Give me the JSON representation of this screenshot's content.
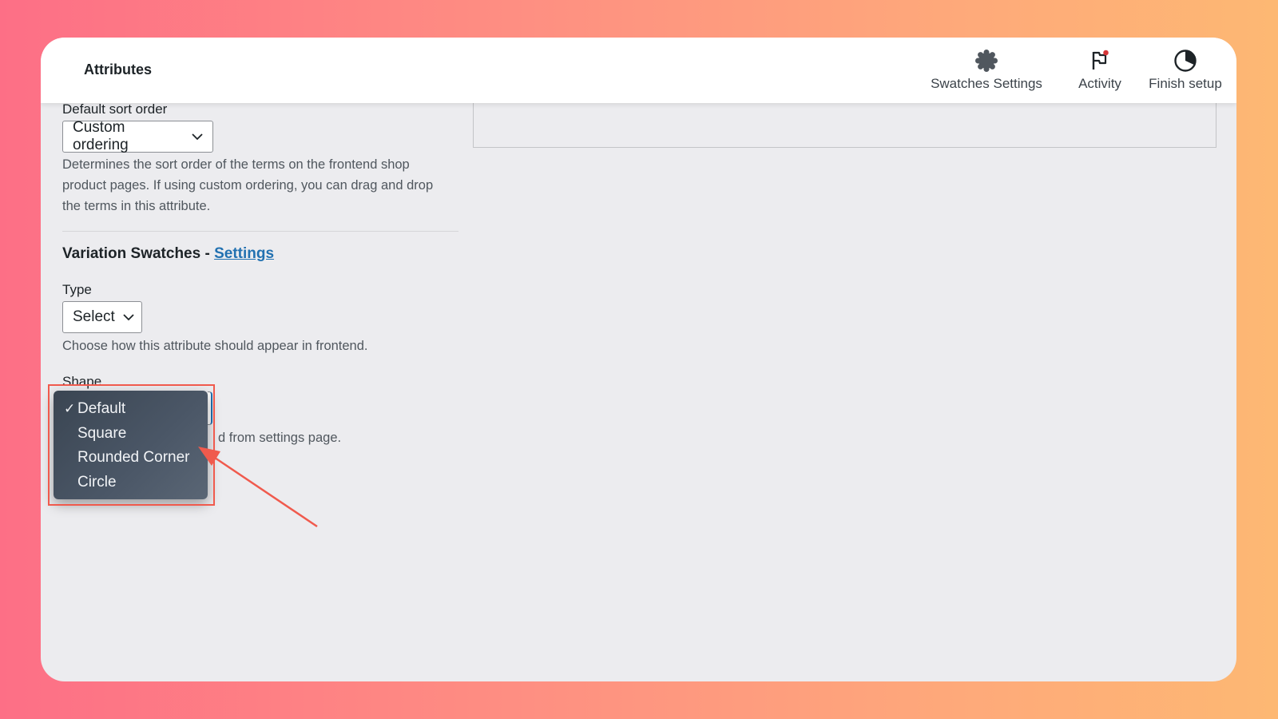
{
  "header": {
    "title": "Attributes",
    "actions": [
      {
        "label": "Swatches Settings",
        "icon": "gear-icon"
      },
      {
        "label": "Activity",
        "icon": "flag-icon"
      },
      {
        "label": "Finish setup",
        "icon": "progress-circle-icon"
      }
    ]
  },
  "sort_order": {
    "label": "Default sort order",
    "value": "Custom ordering",
    "description": "Determines the sort order of the terms on the frontend shop product pages. If using custom ordering, you can drag and drop the terms in this attribute."
  },
  "swatches_section": {
    "title": "Variation Swatches - ",
    "link": "Settings"
  },
  "type": {
    "label": "Type",
    "value": "Select",
    "description": "Choose how this attribute should appear in frontend."
  },
  "shape": {
    "label": "Shape",
    "description_visible": "d from settings page.",
    "options": [
      "Default",
      "Square",
      "Rounded Corner",
      "Circle"
    ],
    "selected": "Default",
    "check_glyph": "✓"
  },
  "colors": {
    "accent": "#2271b1",
    "annotation": "#f05a4d"
  }
}
